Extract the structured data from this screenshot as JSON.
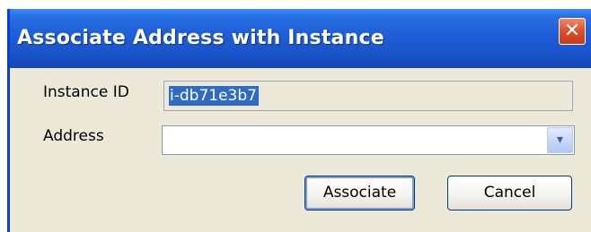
{
  "window": {
    "title": "Associate Address with Instance",
    "close_glyph": "✕"
  },
  "form": {
    "instance_id_label": "Instance ID",
    "instance_id_value": "i-db71e3b7",
    "address_label": "Address",
    "address_value": "",
    "dropdown_glyph": "▾"
  },
  "buttons": {
    "associate_label": "Associate",
    "cancel_label": "Cancel"
  }
}
